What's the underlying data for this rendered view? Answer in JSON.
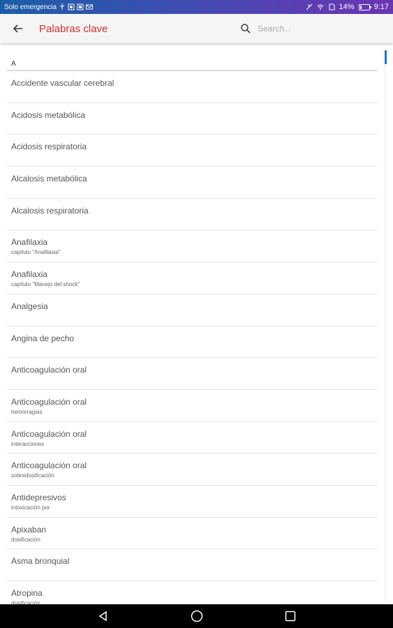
{
  "status_bar": {
    "carrier": "Solo emergencia",
    "battery_text": "14%",
    "battery_level": 0.14,
    "time": "9:17"
  },
  "app_bar": {
    "title": "Palabras clave",
    "title_color": "#d32f2f",
    "back_icon": "arrow-left-icon",
    "search_icon": "search-icon",
    "search_placeholder": "Search..."
  },
  "list": {
    "section_letter": "A",
    "items": [
      {
        "title": "Accidente vascular cerebral",
        "subtitle": ""
      },
      {
        "title": "Acidosis metabólica",
        "subtitle": ""
      },
      {
        "title": "Acidosis respiratoria",
        "subtitle": ""
      },
      {
        "title": "Alcalosis metabólica",
        "subtitle": ""
      },
      {
        "title": "Alcalosis respiratoria",
        "subtitle": ""
      },
      {
        "title": "Anafilaxia",
        "subtitle": "capítulo \"Anafilaxia\""
      },
      {
        "title": "Anafilaxia",
        "subtitle": "capítulo \"Manejo del shock\""
      },
      {
        "title": "Analgesia",
        "subtitle": ""
      },
      {
        "title": "Angina de pecho",
        "subtitle": ""
      },
      {
        "title": "Anticoagulación oral",
        "subtitle": ""
      },
      {
        "title": "Anticoagulación oral",
        "subtitle": "hemorragias"
      },
      {
        "title": "Anticoagulación oral",
        "subtitle": "interacciones"
      },
      {
        "title": "Anticoagulación oral",
        "subtitle": "sobredosificación"
      },
      {
        "title": "Antidepresivos",
        "subtitle": "intoxicación por"
      },
      {
        "title": "Apixaban",
        "subtitle": "dosificación"
      },
      {
        "title": "Asma bronquial",
        "subtitle": ""
      },
      {
        "title": "Atropina",
        "subtitle": "dosificación"
      }
    ],
    "scroll_position": 0.0
  },
  "nav_bar": {
    "back_icon": "triangle-back-icon",
    "home_icon": "circle-home-icon",
    "recents_icon": "square-recents-icon"
  }
}
